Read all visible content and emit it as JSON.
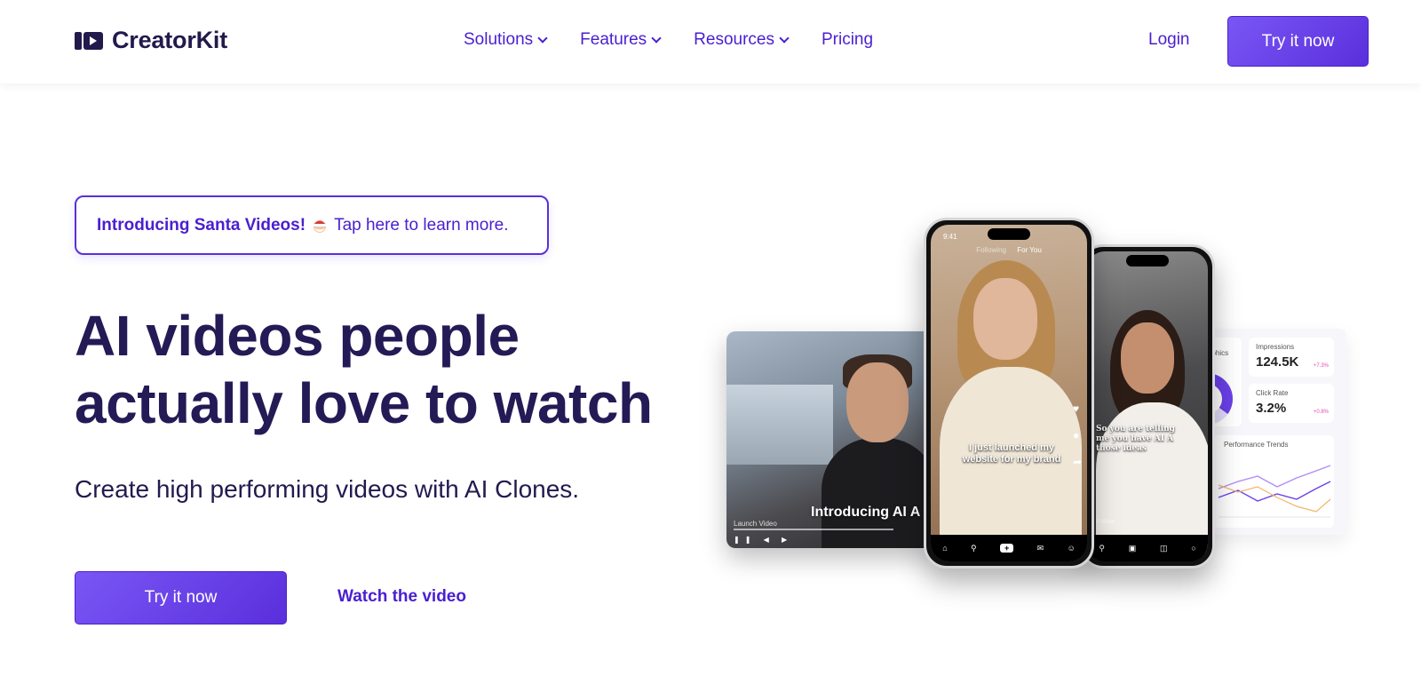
{
  "brand": {
    "name": "CreatorKit"
  },
  "nav": {
    "items": [
      {
        "label": "Solutions",
        "dropdown": true
      },
      {
        "label": "Features",
        "dropdown": true
      },
      {
        "label": "Resources",
        "dropdown": true
      },
      {
        "label": "Pricing",
        "dropdown": false
      }
    ],
    "login": "Login",
    "cta": "Try it now"
  },
  "banner": {
    "bold": "Introducing Santa Videos!",
    "emoji": "santa-emoji",
    "text": "Tap here to learn more."
  },
  "hero": {
    "title_line1": "AI videos people",
    "title_line2": "actually love to watch",
    "subtitle": "Create high performing videos with AI Clones.",
    "cta_primary": "Try it now",
    "cta_secondary": "Watch the video"
  },
  "mockups": {
    "video_card": {
      "title": "Introducing AI A",
      "caption": "Launch Video"
    },
    "phone1": {
      "time": "9:41",
      "tab_following": "Following",
      "tab_foryou": "For You",
      "caption": "I just launched my website for my brand",
      "nav": [
        "Home",
        "Discover",
        "+",
        "Inbox",
        "Me"
      ]
    },
    "phone2": {
      "caption": "So you are telling me you have AI A those ideas",
      "follow": "Follow"
    },
    "dashboard": {
      "donut_title": "aphics",
      "impressions_label": "Impressions",
      "impressions_value": "124.5K",
      "impressions_delta": "+7.3%",
      "click_label": "Click Rate",
      "click_value": "3.2%",
      "click_delta": "+0.8%",
      "trend_title": "Performance Trends"
    }
  },
  "colors": {
    "primary": "#5a2fdc",
    "heading": "#241a55",
    "link": "#4a1fd0"
  }
}
